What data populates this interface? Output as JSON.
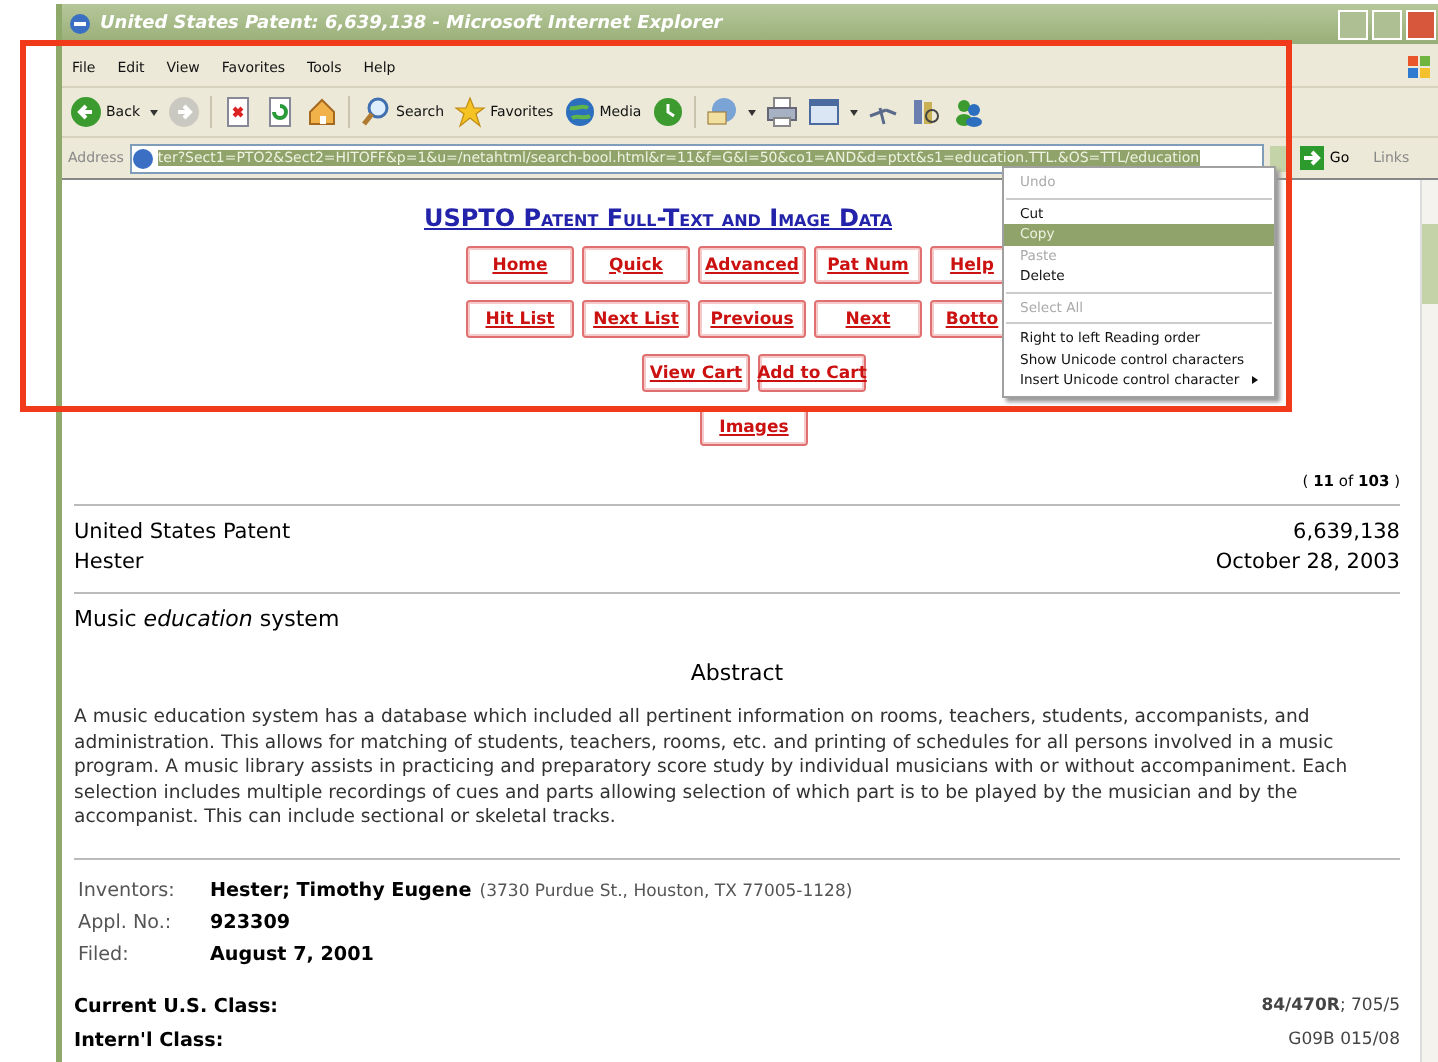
{
  "window": {
    "title": "United States Patent: 6,639,138 - Microsoft Internet Explorer"
  },
  "menu_bar": [
    "File",
    "Edit",
    "View",
    "Favorites",
    "Tools",
    "Help"
  ],
  "toolbar": [
    {
      "kind": "back",
      "label": "Back"
    },
    {
      "kind": "forward"
    },
    {
      "kind": "stop"
    },
    {
      "kind": "refresh"
    },
    {
      "kind": "home"
    },
    {
      "kind": "search",
      "label": "Search"
    },
    {
      "kind": "favorites",
      "label": "Favorites"
    },
    {
      "kind": "media",
      "label": "Media"
    },
    {
      "kind": "history"
    },
    {
      "kind": "mail"
    },
    {
      "kind": "print"
    },
    {
      "kind": "edit"
    },
    {
      "kind": "discuss"
    },
    {
      "kind": "research"
    },
    {
      "kind": "messenger"
    }
  ],
  "address_bar": {
    "label": "Address",
    "url": "ter?Sect1=PTO2&Sect2=HITOFF&p=1&u=/netahtml/search-bool.html&r=11&f=G&l=50&co1=AND&d=ptxt&s1=education.TTL.&OS=TTL/education",
    "url_selected": true,
    "go_label": "Go",
    "links_label": "Links"
  },
  "page": {
    "heading": "USPTO Patent Full-Text and Image Data",
    "nav_rows": [
      [
        "Home",
        "Quick",
        "Advanced",
        "Pat Num",
        "Help"
      ],
      [
        "Hit List",
        "Next List",
        "Previous",
        "Next",
        "Botto"
      ],
      [
        "View Cart",
        "Add to Cart"
      ],
      [
        "Images"
      ]
    ],
    "result_count": "( **11** of **103** )",
    "patent": {
      "label": "United States Patent",
      "number": "6,639,138",
      "inventor": "Hester",
      "date": "October 28, 2003"
    },
    "title": "Music *education* system",
    "abstract_heading": "Abstract",
    "abstract": "A music education system has a database which included all pertinent information on rooms, teachers, students, accompanists, and administration. This allows for matching of students, teachers, rooms, etc. and printing of schedules for all persons involved in a music program. A music library assists in practicing and preparatory score study by individual musicians with or without accompaniment. Each selection includes multiple recordings of cues and parts allowing selection of which part is to be played by the musician and by the accompanist. This can include sectional or skeletal tracks.",
    "details": [
      {
        "label": "Inventors:",
        "value": "Hester; Timothy Eugene",
        "note": "(3730 Purdue St., Houston, TX 77005-1128)"
      },
      {
        "label": "Appl. No.:",
        "value": "923309"
      },
      {
        "label": "Filed:",
        "value": "August 7, 2001"
      }
    ],
    "classes": [
      {
        "label": "Current U.S. Class:",
        "value": "**84/470R**; 705/5"
      },
      {
        "label": "Intern'l Class:",
        "value": "G09B 015/08"
      }
    ]
  },
  "context_menu": [
    {
      "kind": "item",
      "label": "Undo",
      "disabled": true,
      "selected": false,
      "submenu": false
    },
    {
      "kind": "separator"
    },
    {
      "kind": "item",
      "label": "Cut",
      "disabled": false,
      "selected": false,
      "submenu": false
    },
    {
      "kind": "item",
      "label": "Copy",
      "disabled": false,
      "selected": true,
      "submenu": false
    },
    {
      "kind": "item",
      "label": "Paste",
      "disabled": true,
      "selected": false,
      "submenu": false
    },
    {
      "kind": "item",
      "label": "Delete",
      "disabled": false,
      "selected": false,
      "submenu": false
    },
    {
      "kind": "separator"
    },
    {
      "kind": "item",
      "label": "Select All",
      "disabled": true,
      "selected": false,
      "submenu": false
    },
    {
      "kind": "separator"
    },
    {
      "kind": "item",
      "label": "Right to left Reading order",
      "disabled": false,
      "selected": false,
      "submenu": false
    },
    {
      "kind": "item",
      "label": "Show Unicode control characters",
      "disabled": false,
      "selected": false,
      "submenu": false
    },
    {
      "kind": "item",
      "label": "Insert Unicode control character",
      "disabled": false,
      "selected": false,
      "submenu": true
    }
  ]
}
